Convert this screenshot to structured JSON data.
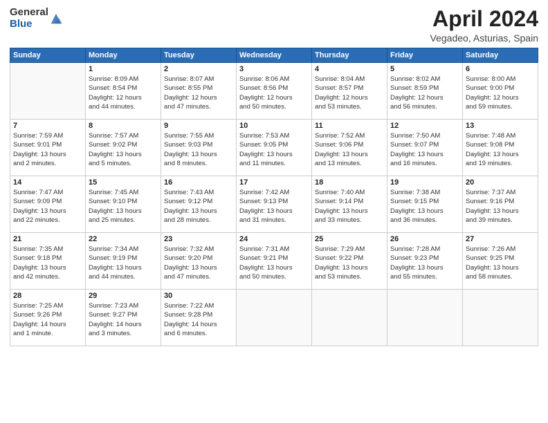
{
  "header": {
    "logo_general": "General",
    "logo_blue": "Blue",
    "month": "April 2024",
    "location": "Vegadeo, Asturias, Spain"
  },
  "weekdays": [
    "Sunday",
    "Monday",
    "Tuesday",
    "Wednesday",
    "Thursday",
    "Friday",
    "Saturday"
  ],
  "weeks": [
    [
      {
        "day": "",
        "info": ""
      },
      {
        "day": "1",
        "info": "Sunrise: 8:09 AM\nSunset: 8:54 PM\nDaylight: 12 hours\nand 44 minutes."
      },
      {
        "day": "2",
        "info": "Sunrise: 8:07 AM\nSunset: 8:55 PM\nDaylight: 12 hours\nand 47 minutes."
      },
      {
        "day": "3",
        "info": "Sunrise: 8:06 AM\nSunset: 8:56 PM\nDaylight: 12 hours\nand 50 minutes."
      },
      {
        "day": "4",
        "info": "Sunrise: 8:04 AM\nSunset: 8:57 PM\nDaylight: 12 hours\nand 53 minutes."
      },
      {
        "day": "5",
        "info": "Sunrise: 8:02 AM\nSunset: 8:59 PM\nDaylight: 12 hours\nand 56 minutes."
      },
      {
        "day": "6",
        "info": "Sunrise: 8:00 AM\nSunset: 9:00 PM\nDaylight: 12 hours\nand 59 minutes."
      }
    ],
    [
      {
        "day": "7",
        "info": "Sunrise: 7:59 AM\nSunset: 9:01 PM\nDaylight: 13 hours\nand 2 minutes."
      },
      {
        "day": "8",
        "info": "Sunrise: 7:57 AM\nSunset: 9:02 PM\nDaylight: 13 hours\nand 5 minutes."
      },
      {
        "day": "9",
        "info": "Sunrise: 7:55 AM\nSunset: 9:03 PM\nDaylight: 13 hours\nand 8 minutes."
      },
      {
        "day": "10",
        "info": "Sunrise: 7:53 AM\nSunset: 9:05 PM\nDaylight: 13 hours\nand 11 minutes."
      },
      {
        "day": "11",
        "info": "Sunrise: 7:52 AM\nSunset: 9:06 PM\nDaylight: 13 hours\nand 13 minutes."
      },
      {
        "day": "12",
        "info": "Sunrise: 7:50 AM\nSunset: 9:07 PM\nDaylight: 13 hours\nand 16 minutes."
      },
      {
        "day": "13",
        "info": "Sunrise: 7:48 AM\nSunset: 9:08 PM\nDaylight: 13 hours\nand 19 minutes."
      }
    ],
    [
      {
        "day": "14",
        "info": "Sunrise: 7:47 AM\nSunset: 9:09 PM\nDaylight: 13 hours\nand 22 minutes."
      },
      {
        "day": "15",
        "info": "Sunrise: 7:45 AM\nSunset: 9:10 PM\nDaylight: 13 hours\nand 25 minutes."
      },
      {
        "day": "16",
        "info": "Sunrise: 7:43 AM\nSunset: 9:12 PM\nDaylight: 13 hours\nand 28 minutes."
      },
      {
        "day": "17",
        "info": "Sunrise: 7:42 AM\nSunset: 9:13 PM\nDaylight: 13 hours\nand 31 minutes."
      },
      {
        "day": "18",
        "info": "Sunrise: 7:40 AM\nSunset: 9:14 PM\nDaylight: 13 hours\nand 33 minutes."
      },
      {
        "day": "19",
        "info": "Sunrise: 7:38 AM\nSunset: 9:15 PM\nDaylight: 13 hours\nand 36 minutes."
      },
      {
        "day": "20",
        "info": "Sunrise: 7:37 AM\nSunset: 9:16 PM\nDaylight: 13 hours\nand 39 minutes."
      }
    ],
    [
      {
        "day": "21",
        "info": "Sunrise: 7:35 AM\nSunset: 9:18 PM\nDaylight: 13 hours\nand 42 minutes."
      },
      {
        "day": "22",
        "info": "Sunrise: 7:34 AM\nSunset: 9:19 PM\nDaylight: 13 hours\nand 44 minutes."
      },
      {
        "day": "23",
        "info": "Sunrise: 7:32 AM\nSunset: 9:20 PM\nDaylight: 13 hours\nand 47 minutes."
      },
      {
        "day": "24",
        "info": "Sunrise: 7:31 AM\nSunset: 9:21 PM\nDaylight: 13 hours\nand 50 minutes."
      },
      {
        "day": "25",
        "info": "Sunrise: 7:29 AM\nSunset: 9:22 PM\nDaylight: 13 hours\nand 53 minutes."
      },
      {
        "day": "26",
        "info": "Sunrise: 7:28 AM\nSunset: 9:23 PM\nDaylight: 13 hours\nand 55 minutes."
      },
      {
        "day": "27",
        "info": "Sunrise: 7:26 AM\nSunset: 9:25 PM\nDaylight: 13 hours\nand 58 minutes."
      }
    ],
    [
      {
        "day": "28",
        "info": "Sunrise: 7:25 AM\nSunset: 9:26 PM\nDaylight: 14 hours\nand 1 minute."
      },
      {
        "day": "29",
        "info": "Sunrise: 7:23 AM\nSunset: 9:27 PM\nDaylight: 14 hours\nand 3 minutes."
      },
      {
        "day": "30",
        "info": "Sunrise: 7:22 AM\nSunset: 9:28 PM\nDaylight: 14 hours\nand 6 minutes."
      },
      {
        "day": "",
        "info": ""
      },
      {
        "day": "",
        "info": ""
      },
      {
        "day": "",
        "info": ""
      },
      {
        "day": "",
        "info": ""
      }
    ]
  ]
}
